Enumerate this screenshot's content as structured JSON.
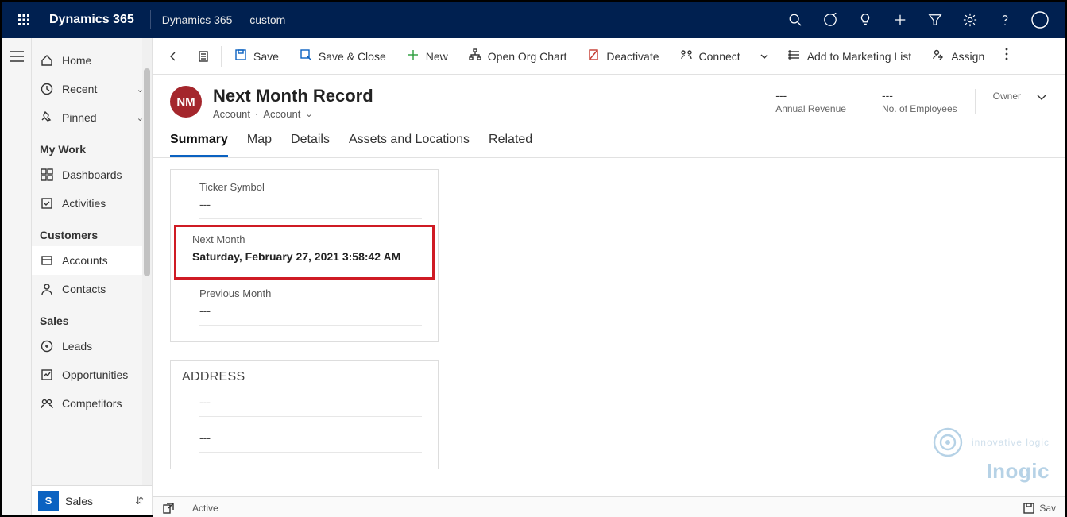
{
  "topbar": {
    "brand": "Dynamics 365",
    "env": "Dynamics 365 — custom"
  },
  "sidebar": {
    "home": "Home",
    "recent": "Recent",
    "pinned": "Pinned",
    "groups": {
      "my_work": "My Work",
      "customers": "Customers",
      "sales": "Sales"
    },
    "items": {
      "dashboards": "Dashboards",
      "activities": "Activities",
      "accounts": "Accounts",
      "contacts": "Contacts",
      "leads": "Leads",
      "opportunities": "Opportunities",
      "competitors": "Competitors"
    },
    "area": {
      "letter": "S",
      "name": "Sales"
    }
  },
  "cmdbar": {
    "save": "Save",
    "save_close": "Save & Close",
    "new": "New",
    "open_org_chart": "Open Org Chart",
    "deactivate": "Deactivate",
    "connect": "Connect",
    "add_marketing": "Add to Marketing List",
    "assign": "Assign"
  },
  "record": {
    "initials": "NM",
    "title": "Next Month Record",
    "entity": "Account",
    "form": "Account",
    "metrics": {
      "annual_revenue": {
        "value": "---",
        "label": "Annual Revenue"
      },
      "num_employees": {
        "value": "---",
        "label": "No. of Employees"
      },
      "owner": {
        "value": "",
        "label": "Owner"
      }
    }
  },
  "tabs": {
    "summary": "Summary",
    "map": "Map",
    "details": "Details",
    "assets": "Assets and Locations",
    "related": "Related"
  },
  "fields": {
    "ticker": {
      "label": "Ticker Symbol",
      "value": "---"
    },
    "next_month": {
      "label": "Next Month",
      "value": "Saturday, February 27, 2021 3:58:42 AM"
    },
    "previous_month": {
      "label": "Previous Month",
      "value": "---"
    },
    "address_title": "ADDRESS",
    "addr1": "---",
    "addr2": "---"
  },
  "status": {
    "state": "Active",
    "save": "Sav"
  },
  "watermark": {
    "line1": "innovative logic",
    "line2": "Inogic"
  }
}
